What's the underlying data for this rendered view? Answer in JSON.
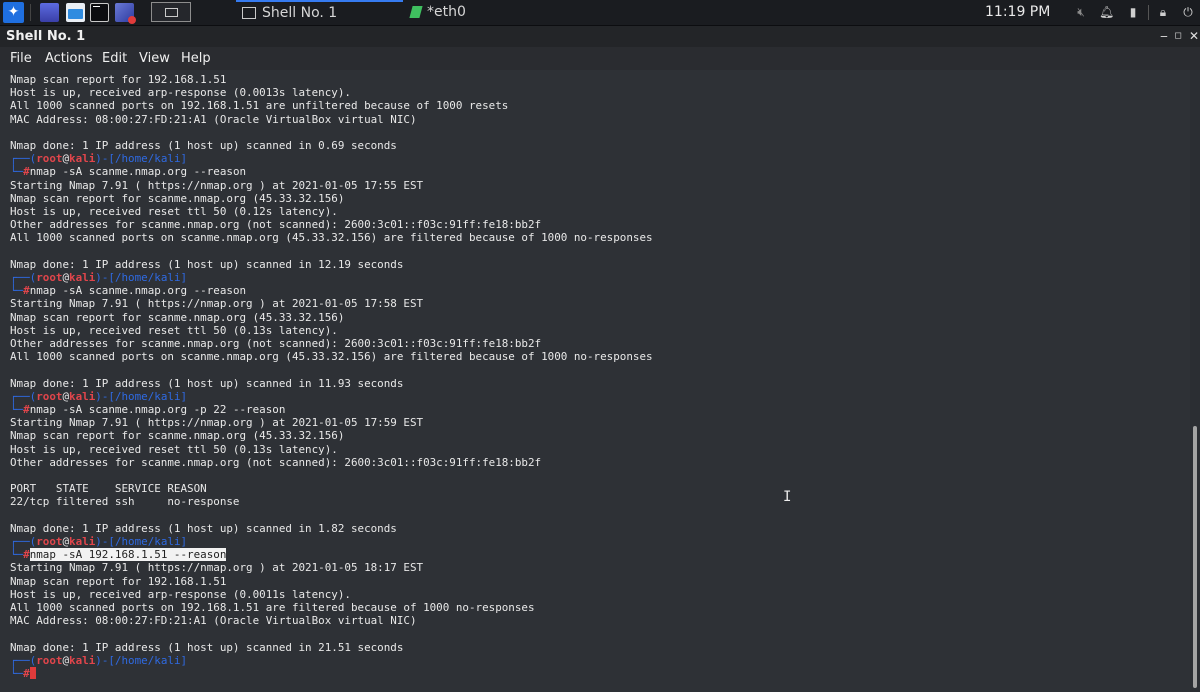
{
  "taskbar": {
    "apps": [
      {
        "name": "kali-menu-icon"
      },
      {
        "name": "show-desktop-icon"
      },
      {
        "name": "file-manager-icon"
      },
      {
        "name": "terminal-icon"
      },
      {
        "name": "burp-suite-icon"
      }
    ],
    "tasks": [
      {
        "label": "Shell No. 1",
        "active": true
      },
      {
        "label": "*eth0",
        "active": false
      }
    ],
    "clock": "11:19 PM",
    "tray": [
      "volume-icon",
      "notification-bell-icon",
      "battery-icon",
      "lock-icon",
      "power-icon"
    ]
  },
  "window": {
    "title": "Shell No. 1",
    "controls": {
      "minimize": "‒",
      "maximize": "◻",
      "close": "✕"
    },
    "menu": [
      "File",
      "Actions",
      "Edit",
      "View",
      "Help"
    ]
  },
  "prompt": {
    "user": "root",
    "at": "@",
    "host": "kali",
    "dir": "/home/kali",
    "hash": "#"
  },
  "terminal": {
    "lines": [
      {
        "type": "out",
        "text": "Nmap scan report for 192.168.1.51"
      },
      {
        "type": "out",
        "text": "Host is up, received arp-response (0.0013s latency)."
      },
      {
        "type": "out",
        "text": "All 1000 scanned ports on 192.168.1.51 are unfiltered because of 1000 resets"
      },
      {
        "type": "out",
        "text": "MAC Address: 08:00:27:FD:21:A1 (Oracle VirtualBox virtual NIC)"
      },
      {
        "type": "out",
        "text": ""
      },
      {
        "type": "out",
        "text": "Nmap done: 1 IP address (1 host up) scanned in 0.69 seconds"
      },
      {
        "type": "prompt"
      },
      {
        "type": "cmd",
        "text": "nmap -sA scanme.nmap.org --reason"
      },
      {
        "type": "out",
        "text": "Starting Nmap 7.91 ( https://nmap.org ) at 2021-01-05 17:55 EST"
      },
      {
        "type": "out",
        "text": "Nmap scan report for scanme.nmap.org (45.33.32.156)"
      },
      {
        "type": "out",
        "text": "Host is up, received reset ttl 50 (0.12s latency)."
      },
      {
        "type": "out",
        "text": "Other addresses for scanme.nmap.org (not scanned): 2600:3c01::f03c:91ff:fe18:bb2f"
      },
      {
        "type": "out",
        "text": "All 1000 scanned ports on scanme.nmap.org (45.33.32.156) are filtered because of 1000 no-responses"
      },
      {
        "type": "out",
        "text": ""
      },
      {
        "type": "out",
        "text": "Nmap done: 1 IP address (1 host up) scanned in 12.19 seconds"
      },
      {
        "type": "prompt"
      },
      {
        "type": "cmd",
        "text": "nmap -sA scanme.nmap.org --reason"
      },
      {
        "type": "out",
        "text": "Starting Nmap 7.91 ( https://nmap.org ) at 2021-01-05 17:58 EST"
      },
      {
        "type": "out",
        "text": "Nmap scan report for scanme.nmap.org (45.33.32.156)"
      },
      {
        "type": "out",
        "text": "Host is up, received reset ttl 50 (0.13s latency)."
      },
      {
        "type": "out",
        "text": "Other addresses for scanme.nmap.org (not scanned): 2600:3c01::f03c:91ff:fe18:bb2f"
      },
      {
        "type": "out",
        "text": "All 1000 scanned ports on scanme.nmap.org (45.33.32.156) are filtered because of 1000 no-responses"
      },
      {
        "type": "out",
        "text": ""
      },
      {
        "type": "out",
        "text": "Nmap done: 1 IP address (1 host up) scanned in 11.93 seconds"
      },
      {
        "type": "prompt"
      },
      {
        "type": "cmd",
        "text": "nmap -sA scanme.nmap.org -p 22 --reason"
      },
      {
        "type": "out",
        "text": "Starting Nmap 7.91 ( https://nmap.org ) at 2021-01-05 17:59 EST"
      },
      {
        "type": "out",
        "text": "Nmap scan report for scanme.nmap.org (45.33.32.156)"
      },
      {
        "type": "out",
        "text": "Host is up, received reset ttl 50 (0.13s latency)."
      },
      {
        "type": "out",
        "text": "Other addresses for scanme.nmap.org (not scanned): 2600:3c01::f03c:91ff:fe18:bb2f"
      },
      {
        "type": "out",
        "text": ""
      },
      {
        "type": "out",
        "text": "PORT   STATE    SERVICE REASON"
      },
      {
        "type": "out",
        "text": "22/tcp filtered ssh     no-response"
      },
      {
        "type": "out",
        "text": ""
      },
      {
        "type": "out",
        "text": "Nmap done: 1 IP address (1 host up) scanned in 1.82 seconds"
      },
      {
        "type": "prompt"
      },
      {
        "type": "cmd",
        "text": "nmap -sA 192.168.1.51 --reason",
        "highlight": true
      },
      {
        "type": "out",
        "text": "Starting Nmap 7.91 ( https://nmap.org ) at 2021-01-05 18:17 EST"
      },
      {
        "type": "out",
        "text": "Nmap scan report for 192.168.1.51"
      },
      {
        "type": "out",
        "text": "Host is up, received arp-response (0.0011s latency)."
      },
      {
        "type": "out",
        "text": "All 1000 scanned ports on 192.168.1.51 are filtered because of 1000 no-responses"
      },
      {
        "type": "out",
        "text": "MAC Address: 08:00:27:FD:21:A1 (Oracle VirtualBox virtual NIC)"
      },
      {
        "type": "out",
        "text": ""
      },
      {
        "type": "out",
        "text": "Nmap done: 1 IP address (1 host up) scanned in 21.51 seconds"
      },
      {
        "type": "prompt"
      },
      {
        "type": "cmd",
        "text": "",
        "cursor": true
      }
    ]
  },
  "colors": {
    "prompt_bracket": "#2f6ae2",
    "prompt_user": "#e0454b",
    "highlight_bg": "#f2f2f2",
    "cursor": "#e03b3b",
    "terminal_bg": "#2e3136"
  }
}
